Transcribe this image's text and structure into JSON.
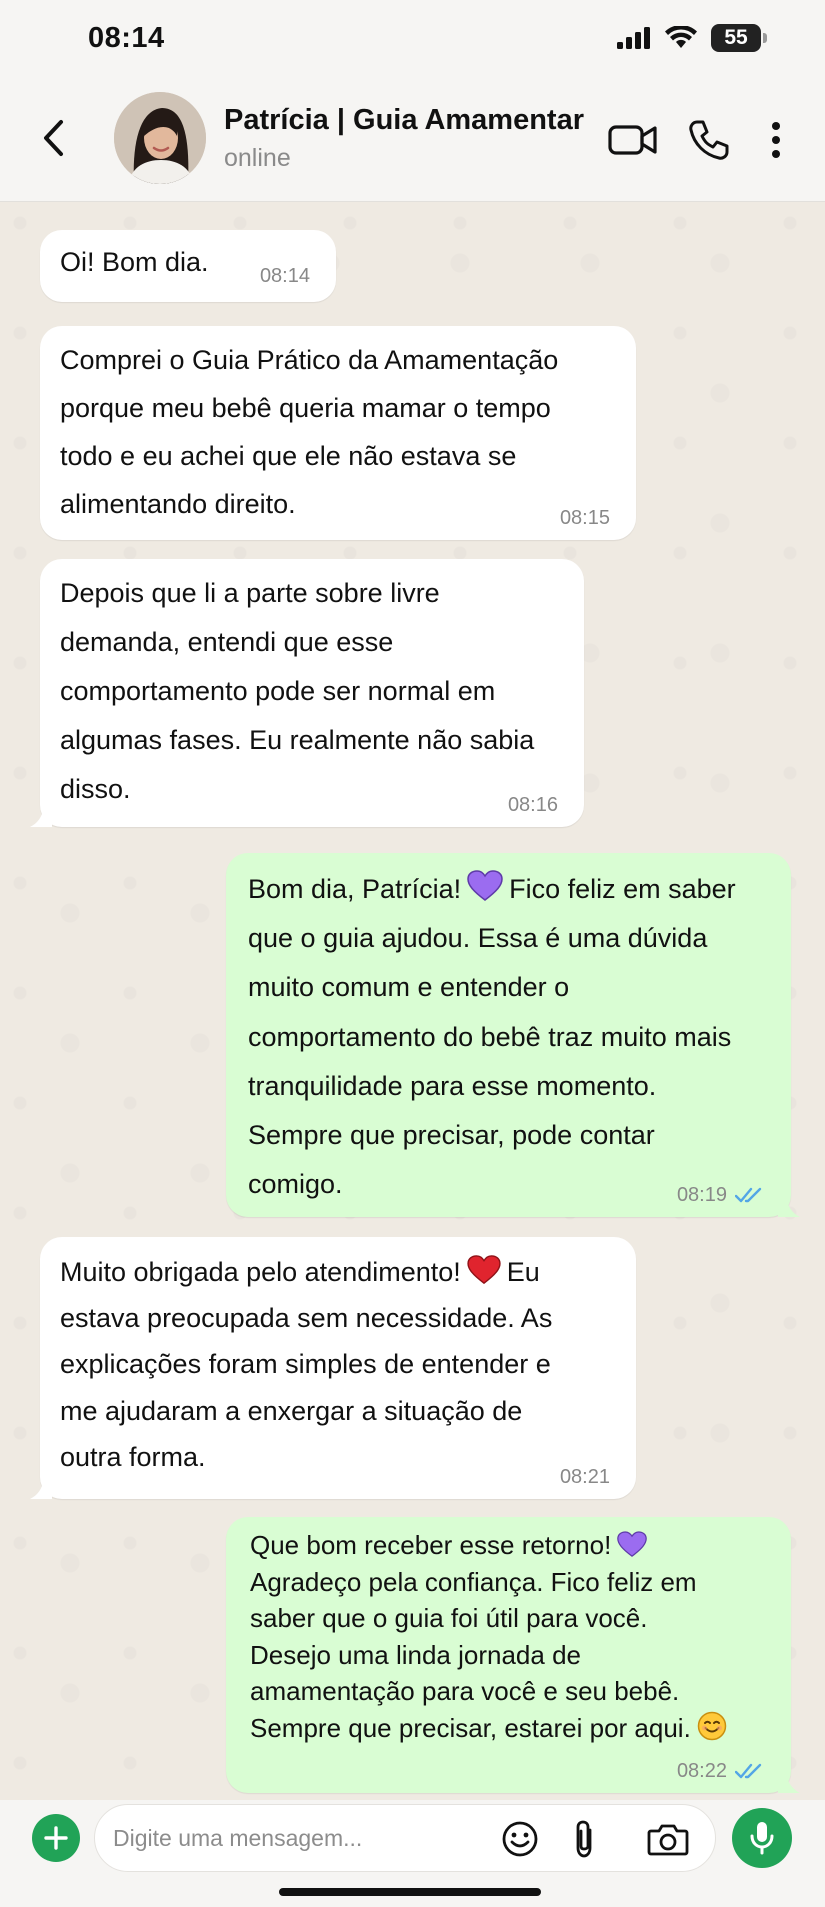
{
  "status_bar": {
    "time": "08:14",
    "battery": "55"
  },
  "header": {
    "contact_name": "Patrícia | Guia Amamentar",
    "status": "online"
  },
  "messages": [
    {
      "direction": "in",
      "text_lines": [
        "Oi! Bom dia."
      ],
      "time": "08:14"
    },
    {
      "direction": "in",
      "text_lines": [
        "Comprei o Guia Prático da Amamentação",
        "porque meu bebê queria mamar o tempo",
        "todo e eu achei que ele não estava se",
        "alimentando direito."
      ],
      "time": "08:15"
    },
    {
      "direction": "in",
      "text_lines": [
        "Depois que li a parte sobre livre",
        "demanda, entendi que esse",
        "comportamento pode ser normal em",
        "algumas fases. Eu realmente não sabia",
        "disso."
      ],
      "time": "08:16"
    },
    {
      "direction": "out",
      "text_lines": [
        "Bom dia, Patrícia!",
        "Fico feliz em saber",
        "que o guia ajudou. Essa é uma dúvida",
        "muito comum e entender o",
        "comportamento do bebê traz muito mais",
        "tranquilidade para esse momento.",
        "Sempre que precisar, pode contar",
        "comigo."
      ],
      "time": "08:19",
      "read": true
    },
    {
      "direction": "in",
      "text_lines": [
        "Muito obrigada pelo atendimento!",
        "Eu",
        "estava preocupada sem necessidade. As",
        "explicações foram simples de entender e",
        "me ajudaram a enxergar a situação de",
        "outra forma."
      ],
      "time": "08:21"
    },
    {
      "direction": "out",
      "text_lines": [
        "Que bom receber esse retorno!",
        "Agradeço pela confiança. Fico feliz em",
        "saber que o guia foi útil para você.",
        "Desejo uma linda jornada de",
        "amamentação para você e seu bebê.",
        "Sempre que precisar, estarei por aqui."
      ],
      "time": "08:22",
      "read": true
    }
  ],
  "input": {
    "placeholder": "Digite uma mensagem..."
  },
  "colors": {
    "chat_bg": "#efeae2",
    "incoming_bubble": "#ffffff",
    "outgoing_bubble": "#d9fdd3",
    "accent_green": "#21a357",
    "read_tick": "#53a6e6"
  },
  "icons": [
    "back-arrow-icon",
    "video-call-icon",
    "phone-icon",
    "more-vertical-icon",
    "purple-heart-icon",
    "red-heart-icon",
    "smiling-face-icon",
    "double-check-icon",
    "plus-icon",
    "emoji-icon",
    "paperclip-icon",
    "camera-icon",
    "microphone-icon"
  ]
}
